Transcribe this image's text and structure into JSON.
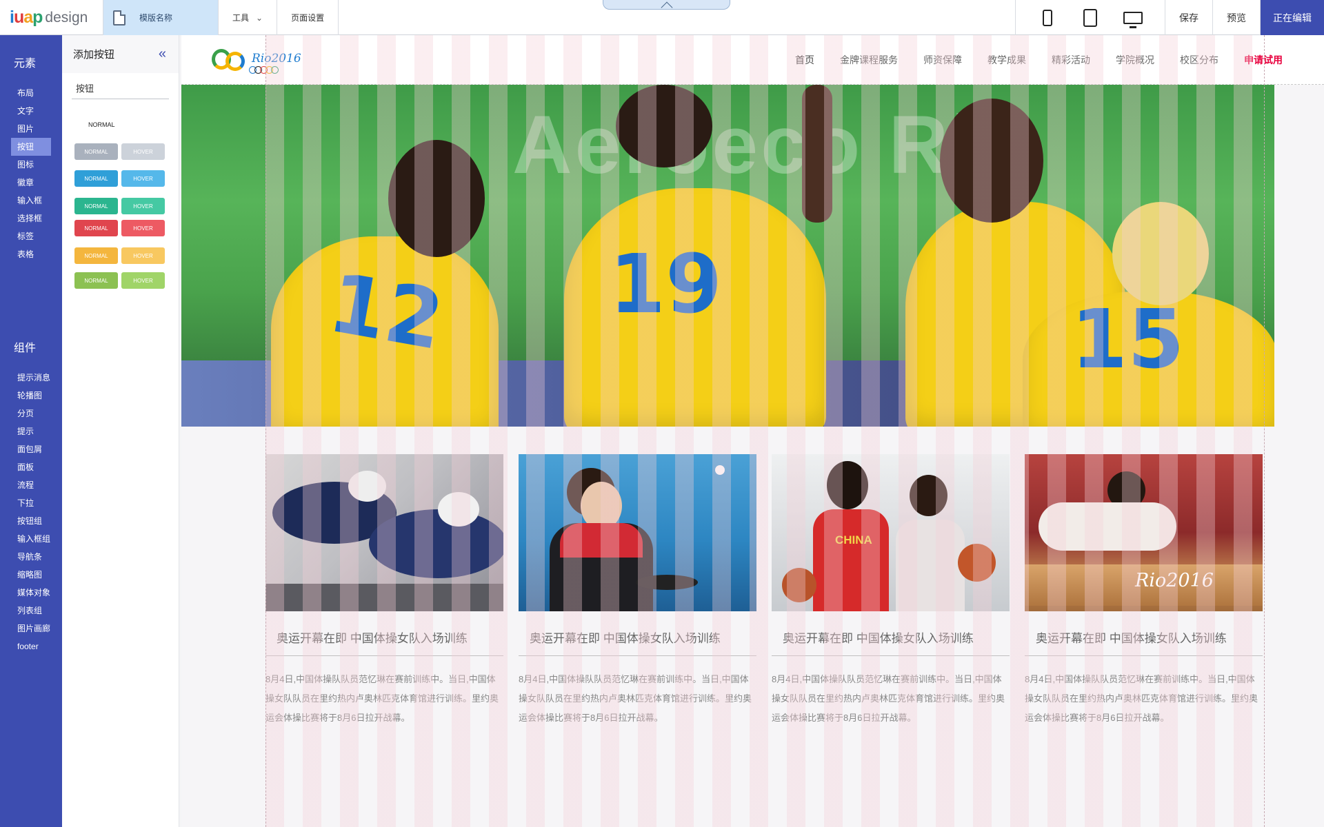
{
  "toolbar": {
    "logo_iuap": "iuap",
    "logo_design": "design",
    "template_name": "模版名称",
    "tools_label": "工具",
    "page_settings_label": "页面设置",
    "save_label": "保存",
    "preview_label": "预览",
    "editing_label": "正在编辑",
    "devices": [
      "phone-icon",
      "tablet-icon",
      "desktop-icon"
    ]
  },
  "rail": {
    "elements_heading": "元素",
    "elements": [
      "布局",
      "文字",
      "图片",
      "按钮",
      "图标",
      "徽章",
      "输入框",
      "选择框",
      "标签",
      "表格"
    ],
    "active_element": "按钮",
    "components_heading": "组件",
    "components": [
      "提示消息",
      "轮播图",
      "分页",
      "提示",
      "面包屑",
      "面板",
      "流程",
      "下拉",
      "按钮组",
      "输入框组",
      "导航条",
      "缩略图",
      "媒体对象",
      "列表组",
      "图片画廊",
      "footer"
    ]
  },
  "panel": {
    "title": "添加按钮",
    "search_value": "按钮",
    "normal_label": "NORMAL",
    "button_rows": [
      {
        "normal": "NORMAL",
        "hover": "HOVER",
        "normal_color": "#a9b1bd",
        "hover_color": "#ccd2da"
      },
      {
        "normal": "NORMAL",
        "hover": "HOVER",
        "normal_color": "#2f9fd8",
        "hover_color": "#55b8ea"
      },
      {
        "normal": "NORMAL",
        "hover": "HOVER",
        "normal_color": "#2bb58f",
        "hover_color": "#45c9a3"
      },
      {
        "normal": "NORMAL",
        "hover": "HOVER",
        "normal_color": "#e0454e",
        "hover_color": "#ed5a63"
      },
      {
        "normal": "NORMAL",
        "hover": "HOVER",
        "normal_color": "#f4b63e",
        "hover_color": "#f8c860"
      },
      {
        "normal": "NORMAL",
        "hover": "HOVER",
        "normal_color": "#8cc152",
        "hover_color": "#a0d468"
      }
    ]
  },
  "site": {
    "logo_text": "Rio2016",
    "nav": [
      "首页",
      "金牌课程服务",
      "师资保障",
      "教学成果",
      "精彩活动",
      "学院概况",
      "校区分布"
    ],
    "cta": "申请试用",
    "hero_sign": "Aeroeco Rio",
    "jersey_numbers": [
      "12",
      "19",
      "15"
    ],
    "cards": [
      {
        "title": "奥运开幕在即 中国体操女队入场训练",
        "desc": "8月4日,中国体操队队员范忆琳在赛前训练中。当日,中国体操女队队员在里约热内卢奥林匹克体育馆进行训练。里约奥运会体操比赛将于8月6日拉开战幕。",
        "image": "cycling-photo"
      },
      {
        "title": "奥运开幕在即 中国体操女队入场训练",
        "desc": "8月4日,中国体操队队员范忆琳在赛前训练中。当日,中国体操女队队员在里约热内卢奥林匹克体育馆进行训练。里约奥运会体操比赛将于8月6日拉开战幕。",
        "image": "table-tennis-photo"
      },
      {
        "title": "奥运开幕在即 中国体操女队入场训练",
        "desc": "8月4日,中国体操队队员范忆琳在赛前训练中。当日,中国体操女队队员在里约热内卢奥林匹克体育馆进行训练。里约奥运会体操比赛将于8月6日拉开战幕。",
        "image": "basketball-photo"
      },
      {
        "title": "奥运开幕在即 中国体操女队入场训练",
        "desc": "8月4日,中国体操队队员范忆琳在赛前训练中。当日,中国体操女队队员在里约热内卢奥林匹克体育馆进行训练。里约奥运会体操比赛将于8月6日拉开战幕。",
        "image": "gymnastics-photo"
      }
    ],
    "card2_sign": "CHINA",
    "card4_sign": "Rio2016"
  }
}
